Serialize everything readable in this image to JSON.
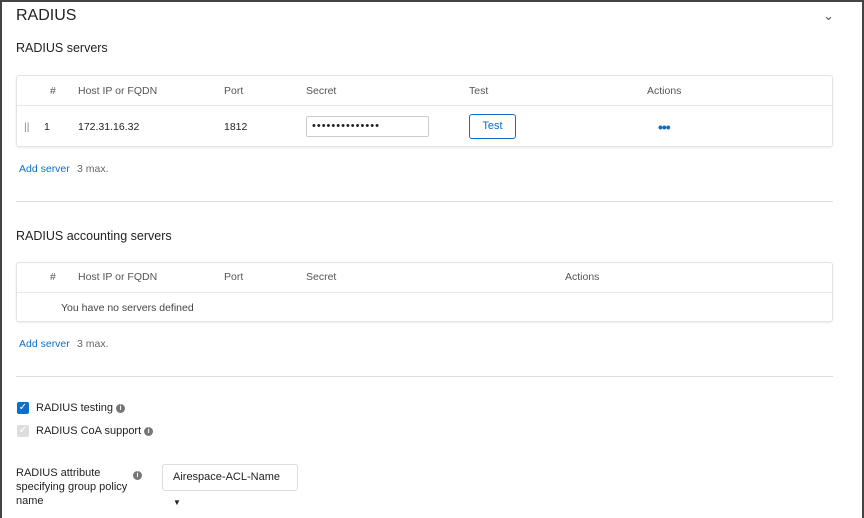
{
  "section": {
    "title": "RADIUS"
  },
  "servers": {
    "heading": "RADIUS servers",
    "columns": [
      "#",
      "Host IP or FQDN",
      "Port",
      "Secret",
      "Test",
      "Actions"
    ],
    "rows": [
      {
        "index": "1",
        "host": "172.31.16.32",
        "port": "1812",
        "secret": "••••••••••••••",
        "test_label": "Test",
        "actions": "•••"
      }
    ],
    "add_label": "Add server",
    "max_note": "3 max."
  },
  "accounting": {
    "heading": "RADIUS accounting servers",
    "columns": [
      "#",
      "Host IP or FQDN",
      "Port",
      "Secret",
      "Actions"
    ],
    "empty": "You have no servers defined",
    "add_label": "Add server",
    "max_note": "3 max."
  },
  "options": {
    "testing": {
      "label": "RADIUS testing",
      "checked": true
    },
    "coa": {
      "label": "RADIUS CoA support",
      "checked": true,
      "disabled": true
    },
    "group_policy": {
      "label": "RADIUS attribute specifying group policy name",
      "value": "Airespace-ACL-Name"
    }
  },
  "colors": {
    "accent": "#0b6fc7"
  }
}
